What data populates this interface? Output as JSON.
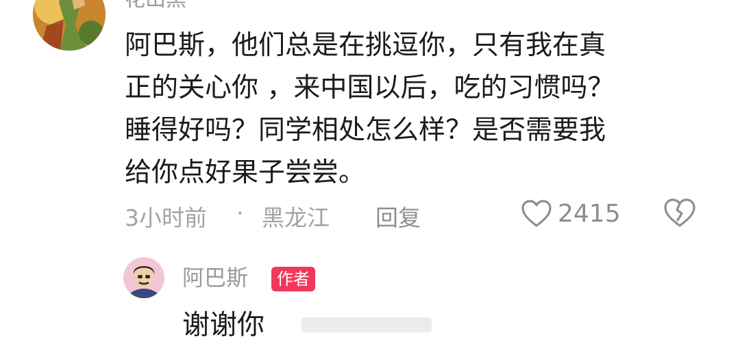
{
  "comment": {
    "username": "花山黑",
    "text_lines": [
      "阿巴斯，他们总是在挑逗你，只有我在真",
      "正的关心你 ，来中国以后，吃的习惯吗？",
      "睡得好吗？同学相处怎么样？是否需要我",
      "给你点好果子尝尝。"
    ],
    "time": "3小时前",
    "separator": "·",
    "location": "黑龙江",
    "reply_label": "回复",
    "like_count": "2415",
    "icons": [
      "heart-outline-icon",
      "broken-heart-icon"
    ]
  },
  "reply": {
    "username": "阿巴斯",
    "badge": "作者",
    "text": "谢谢你"
  },
  "colors": {
    "badge_bg": "#f1375a",
    "meta_gray": "#a3a3a3",
    "text": "#1b1b1b"
  }
}
